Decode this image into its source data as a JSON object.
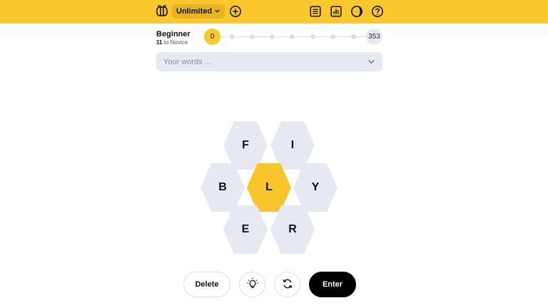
{
  "header": {
    "mode_label": "Unlimited",
    "icons": [
      "bee-logo-icon",
      "chevron-down-icon",
      "plus-circle-icon",
      "list-icon",
      "bar-chart-icon",
      "dark-mode-icon",
      "help-icon"
    ]
  },
  "rank": {
    "title": "Beginner",
    "points_to_next": "11",
    "next_rank_text": "to Novice"
  },
  "progress": {
    "current_score": "0",
    "max_score": "353",
    "milestones_count": 8
  },
  "words": {
    "placeholder": "Your words ..."
  },
  "hive": {
    "center_letter": "L",
    "letters": {
      "top_left": "F",
      "top_right": "I",
      "mid_left": "B",
      "mid_right": "Y",
      "bottom_left": "E",
      "bottom_right": "R"
    },
    "center_color": "#f7c42a",
    "outer_color": "#e6e9f2"
  },
  "controls": {
    "delete_label": "Delete",
    "enter_label": "Enter"
  },
  "colors": {
    "brand_yellow": "#fac82a",
    "pill_yellow": "#e8b41d"
  }
}
